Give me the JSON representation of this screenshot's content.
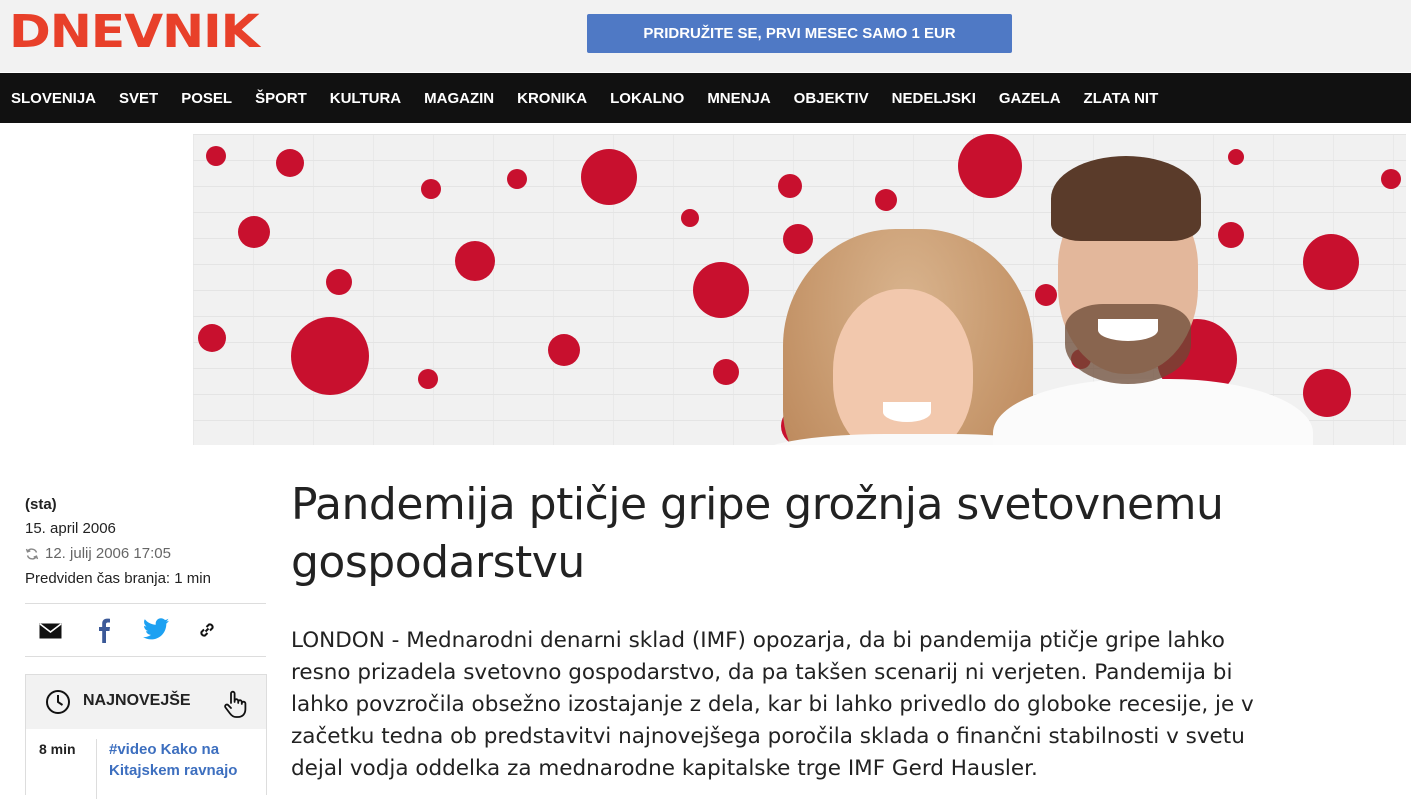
{
  "header": {
    "logo": "DNEVNIK",
    "promo": "PRIDRUŽITE SE, PRVI MESEC SAMO 1 EUR"
  },
  "nav": {
    "items": [
      "SLOVENIJA",
      "SVET",
      "POSEL",
      "ŠPORT",
      "KULTURA",
      "MAGAZIN",
      "KRONIKA",
      "LOKALNO",
      "MNENJA",
      "OBJEKTIV",
      "NEDELJSKI",
      "GAZELA",
      "ZLATA NIT"
    ]
  },
  "meta": {
    "source": "(sta)",
    "published": "15. april 2006",
    "updated": "12. julij 2006 17:05",
    "reading_time": "Predviden čas branja: 1 min"
  },
  "share": {
    "icons": [
      "email-icon",
      "facebook-icon",
      "twitter-icon",
      "link-icon"
    ]
  },
  "latest": {
    "title": "NAJNOVEJŠE",
    "items": [
      {
        "time": "8 min",
        "text": "#video Kako na Kitajskem ravnajo"
      }
    ]
  },
  "article": {
    "headline": "Pandemija ptičje gripe grožnja svetovnemu gospodarstvu",
    "lead": "LONDON - Mednarodni denarni sklad (IMF) opozarja, da bi pandemija ptičje gripe lahko resno prizadela svetovno gospodarstvo, da pa takšen scenarij ni verjeten. Pandemija bi lahko povzročila obsežno izostajanje z dela, kar bi lahko privedlo do globoke recesije, je v začetku tedna ob predstavitvi najnovejšega poročila sklada o finančni stabilnosti v svetu dejal vodja oddelka za mednarodne kapitalske trge IMF Gerd Hausler."
  },
  "colors": {
    "logo": "#e8402a",
    "promo_button": "#4f79c5",
    "navbar": "#111111",
    "link": "#3d6fbf",
    "banner_dots": "#c8102e"
  }
}
